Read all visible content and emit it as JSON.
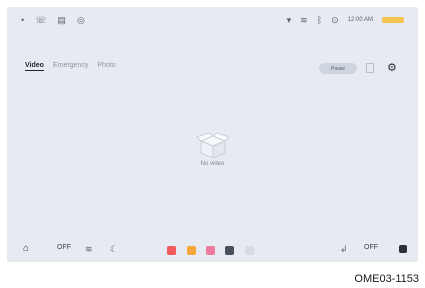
{
  "tabs": [
    {
      "label": "Video",
      "active": true
    },
    {
      "label": "Emergency",
      "active": false
    },
    {
      "label": "Photo",
      "active": false
    }
  ],
  "toolbar": {
    "pill_label": "Pause"
  },
  "statusbar": {
    "time": "12:00 AM"
  },
  "empty_state": {
    "message": "No video"
  },
  "bottombar": {
    "left_off": "OFF",
    "right_off": "OFF"
  },
  "caption": "OME03-1153",
  "colors": {
    "screen_bg": "#e7ebf1",
    "accent_red": "#f05a5a",
    "accent_orange": "#f4a63a",
    "accent_pink": "#ef7aa0",
    "accent_dark": "#4a4f5c",
    "brand_badge": "#f5c451"
  }
}
